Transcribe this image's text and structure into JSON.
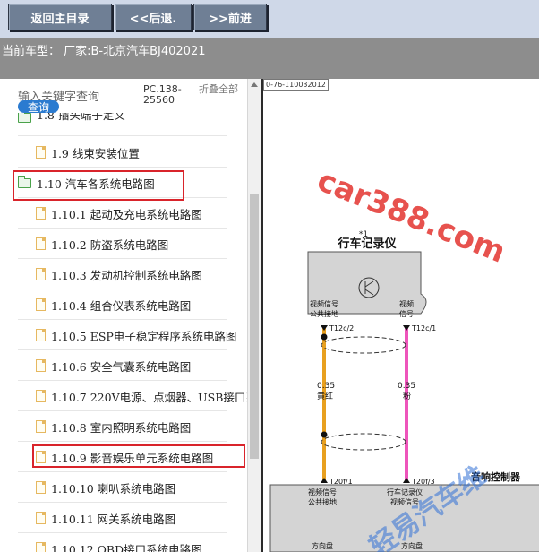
{
  "toolbar": {
    "home_label": "返回主目录",
    "back_label": "<<后退.",
    "forward_label": ">>前进"
  },
  "car_bar": {
    "text": "当前车型： 厂家:B-北京汽车BJ402021"
  },
  "search": {
    "placeholder": "输入关键字查询",
    "button_label": "查询",
    "code": "PC.138-25560",
    "collapse_label": "折叠全部"
  },
  "tree": {
    "partial_top": "1.8 插头端子定义",
    "items": [
      {
        "label": "1.9 线束安装位置",
        "icon": "document-icon"
      },
      {
        "label": "1.10 汽车各系统电路图",
        "icon": "folder-open-icon"
      },
      {
        "label": "1.10.1 起动及充电系统电路图",
        "icon": "document-icon"
      },
      {
        "label": "1.10.2 防盗系统电路图",
        "icon": "document-icon"
      },
      {
        "label": "1.10.3 发动机控制系统电路图",
        "icon": "document-icon"
      },
      {
        "label": "1.10.4 组合仪表系统电路图",
        "icon": "document-icon"
      },
      {
        "label": "1.10.5 ESP电子稳定程序系统电路图",
        "icon": "document-icon"
      },
      {
        "label": "1.10.6 安全气囊系统电路图",
        "icon": "document-icon"
      },
      {
        "label": "1.10.7 220V电源、点烟器、USB接口系统电路图",
        "icon": "document-icon"
      },
      {
        "label": "1.10.8 室内照明系统电路图",
        "icon": "document-icon"
      },
      {
        "label": "1.10.9 影音娱乐单元系统电路图",
        "icon": "document-icon"
      },
      {
        "label": "1.10.10 喇叭系统电路图",
        "icon": "document-icon"
      },
      {
        "label": "1.10.11 网关系统电路图",
        "icon": "document-icon"
      },
      {
        "label": "1.10.12 OBD接口系统电路图",
        "icon": "document-icon"
      }
    ]
  },
  "diagram": {
    "doc_ref": "0-76-110032012",
    "note": "*1",
    "recorder_title": "行车记录仪",
    "left_signal": [
      "视频信号",
      "公共接地"
    ],
    "right_signal": [
      "视频",
      "信号"
    ],
    "pin_t12c2": "T12c/2",
    "pin_t12c1": "T12c/1",
    "wire_left_gauge": "0.35",
    "wire_left_color": "黄红",
    "wire_right_gauge": "0.35",
    "wire_right_color": "粉",
    "pin_t20f1": "T20f/1",
    "pin_t20f3": "T20f/3",
    "audio_controller": "音响控制器",
    "bottom_left": [
      "视频信号",
      "公共接地"
    ],
    "bottom_right": [
      "行车记录仪",
      "视频信号"
    ],
    "steering_left": "方向盘",
    "steering_right": "方向盘",
    "watermark_top": "car388.com",
    "watermark_bottom": "轻易汽车维"
  },
  "colors": {
    "highlight_border": "#d9242b",
    "wire_left": "#e8a020",
    "wire_right": "#ee55bb",
    "watermark": "#e3342f",
    "watermark_bottom": "#2f6fd6"
  }
}
